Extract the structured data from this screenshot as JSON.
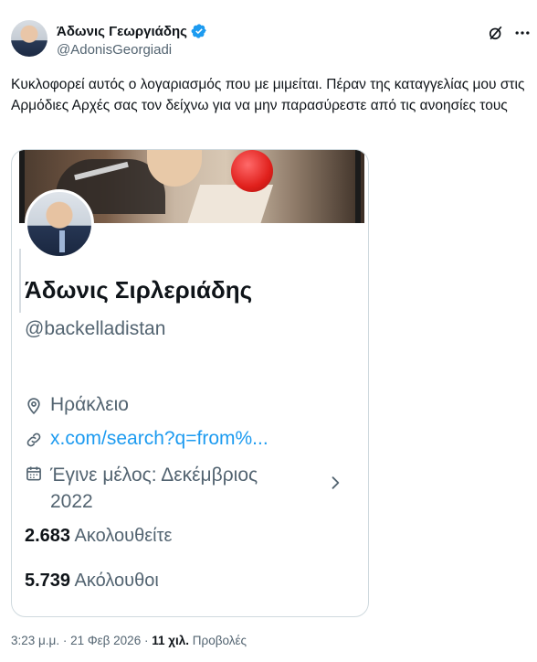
{
  "author": {
    "name": "Άδωνις Γεωργιάδης",
    "handle": "@AdonisGeorgiadi",
    "verified": true
  },
  "icons": {
    "grok": "grok-icon",
    "more": "more-icon",
    "verified": "verified-badge-icon",
    "location": "location-pin-icon",
    "link": "link-icon",
    "calendar": "calendar-icon",
    "chevron": "chevron-right-icon"
  },
  "colors": {
    "text": "#0f1419",
    "secondary": "#536471",
    "link": "#1d9bf0",
    "verified": "#1d9bf0",
    "border": "#cfd9de"
  },
  "tweet": {
    "text": "Κυκλοφορεί αυτός ο λογαριασμός που με μιμείται. Πέραν της καταγγελίας μου στις Αρμόδιες Αρχές σας τον δείχνω για να μην παρασύρεστε από τις ανοησίες τους"
  },
  "embedded_profile": {
    "name": "Άδωνις Σιρλεριάδης",
    "handle": "@backelladistan",
    "location": "Ηράκλειο",
    "link": "x.com/search?q=from%...",
    "joined": "Έγινε μέλος: Δεκέμβριος 2022",
    "following_count": "2.683",
    "following_label": "Ακολουθείτε",
    "followers_count": "5.739",
    "followers_label": "Ακόλουθοι"
  },
  "meta": {
    "time": "3:23 μ.μ.",
    "separator1": " · ",
    "date": "21 Φεβ 2026",
    "separator2": " · ",
    "views_count": "11 χιλ.",
    "views_label": "Προβολές"
  }
}
